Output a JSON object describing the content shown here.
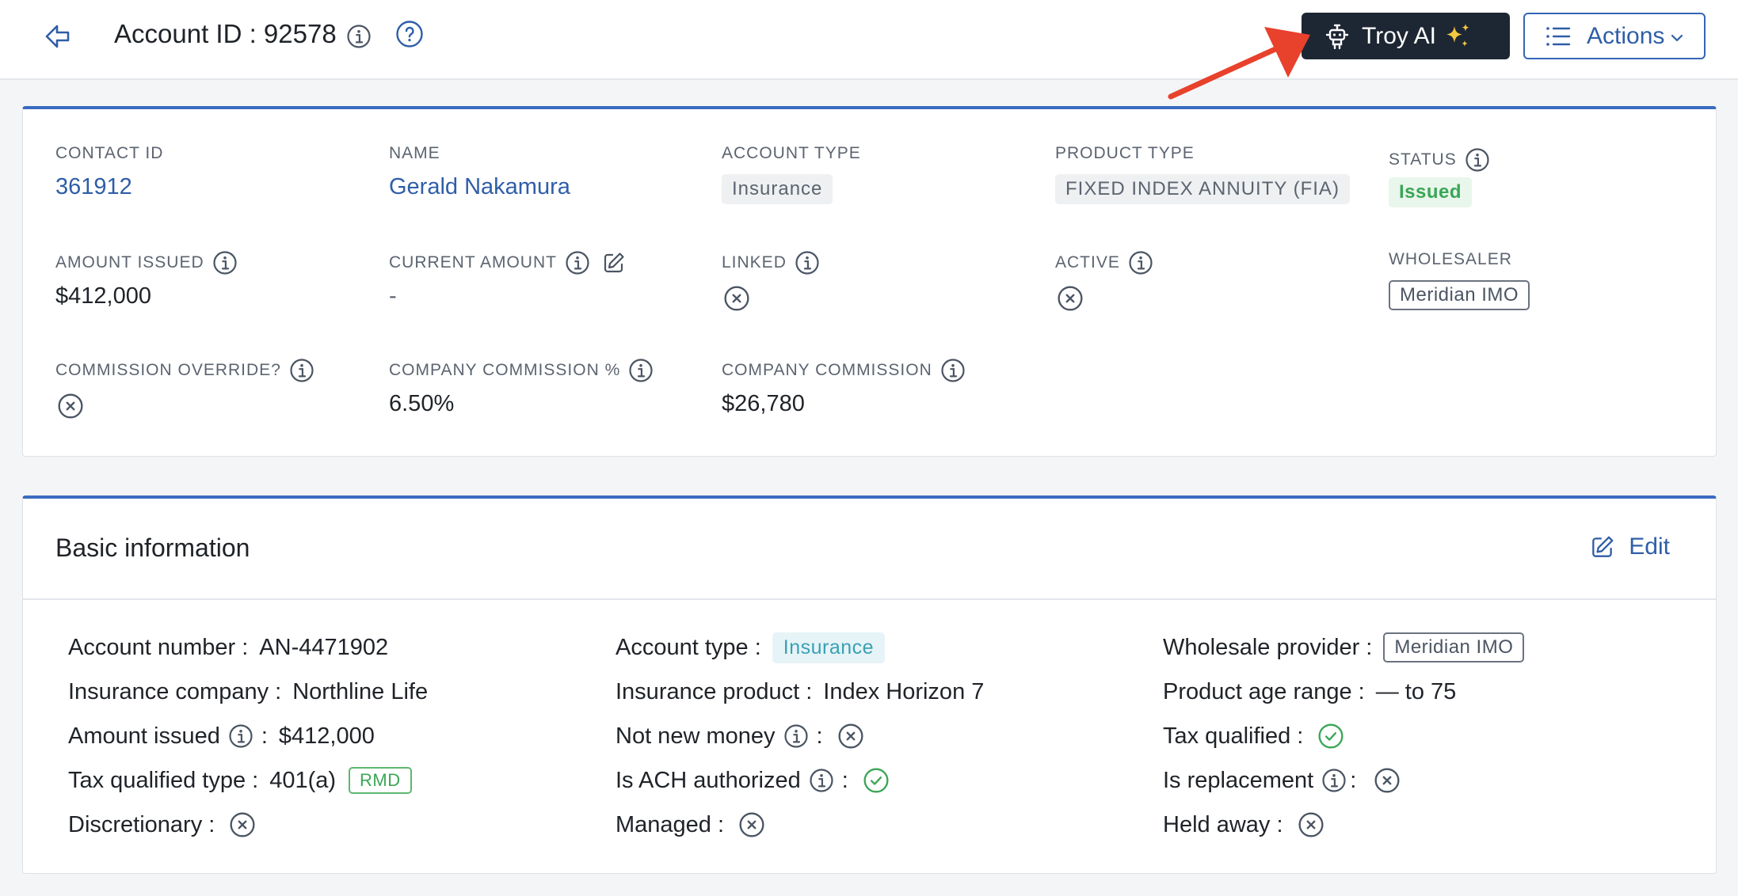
{
  "header": {
    "title": "Account ID : 92578",
    "troy_label": "Troy AI",
    "actions_label": "Actions"
  },
  "summary": {
    "contact_id": {
      "label": "CONTACT ID",
      "value": "361912"
    },
    "name": {
      "label": "NAME",
      "value": "Gerald Nakamura"
    },
    "account_type": {
      "label": "ACCOUNT TYPE",
      "value": "Insurance"
    },
    "product_type": {
      "label": "PRODUCT TYPE",
      "value": "FIXED INDEX ANNUITY (FIA)"
    },
    "status": {
      "label": "STATUS",
      "value": "Issued"
    },
    "amount_issued": {
      "label": "AMOUNT ISSUED",
      "value": "$412,000"
    },
    "current_amount": {
      "label": "CURRENT AMOUNT",
      "value": "-"
    },
    "linked": {
      "label": "LINKED"
    },
    "active": {
      "label": "ACTIVE"
    },
    "wholesaler": {
      "label": "WHOLESALER",
      "value": "Meridian IMO"
    },
    "commission_override": {
      "label": "COMMISSION OVERRIDE?"
    },
    "company_commission_pct": {
      "label": "COMPANY COMMISSION %",
      "value": "6.50%"
    },
    "company_commission": {
      "label": "COMPANY COMMISSION",
      "value": "$26,780"
    }
  },
  "basic": {
    "title": "Basic information",
    "edit_label": "Edit",
    "account_number": {
      "label": "Account number :",
      "value": "AN-4471902"
    },
    "insurance_company": {
      "label": "Insurance company :",
      "value": "Northline Life"
    },
    "amount_issued": {
      "label": "Amount issued",
      "value": "$412,000"
    },
    "tax_qualified_type": {
      "label": "Tax qualified type :",
      "value": "401(a)",
      "badge": "RMD"
    },
    "discretionary": {
      "label": "Discretionary :"
    },
    "account_type": {
      "label": "Account type :",
      "value": "Insurance"
    },
    "insurance_product": {
      "label": "Insurance product :",
      "value": "Index Horizon 7"
    },
    "not_new_money": {
      "label": "Not new money"
    },
    "is_ach_authorized": {
      "label": "Is ACH authorized"
    },
    "managed": {
      "label": "Managed :"
    },
    "wholesale_provider": {
      "label": "Wholesale provider :",
      "value": "Meridian IMO"
    },
    "product_age_range": {
      "label": "Product age range :",
      "value": "— to 75"
    },
    "tax_qualified": {
      "label": "Tax qualified :"
    },
    "is_replacement": {
      "label": "Is replacement"
    },
    "held_away": {
      "label": "Held away :"
    }
  },
  "colors": {
    "accent": "#2f5ea8",
    "card_top": "#3a6bc0",
    "troy_bg": "#1d2733",
    "success": "#3aa655",
    "annotation_arrow": "#e8412c"
  },
  "icons": [
    "back-arrow-icon",
    "info-icon",
    "help-icon",
    "robot-icon",
    "sparkle-icon",
    "list-icon",
    "chevron-down-icon",
    "edit-icon",
    "x-circle-icon",
    "check-circle-icon"
  ]
}
